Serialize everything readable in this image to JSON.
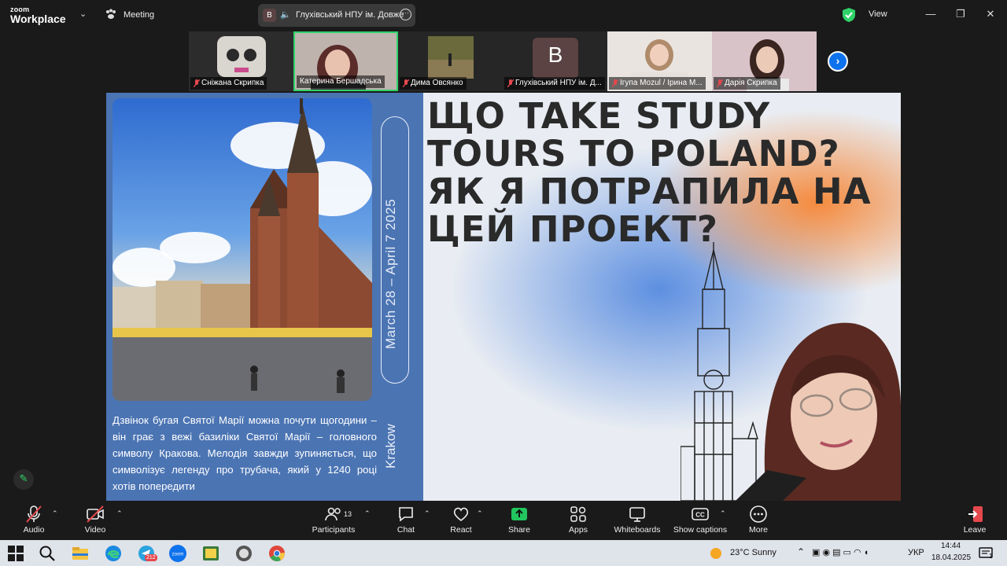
{
  "app": {
    "logo_top": "zoom",
    "logo_bottom": "Workplace",
    "meeting_label": "Meeting",
    "speaker_initial": "B",
    "speaker_name": "Глухівський НПУ ім. Довже",
    "view_label": "View"
  },
  "participants_strip": [
    {
      "name": "Сніжана Скрипка",
      "muted": true
    },
    {
      "name": "Катерина Бершадська",
      "muted": false,
      "active": true
    },
    {
      "name": "Дима Овсянко",
      "muted": true
    },
    {
      "name": "Глухівський НПУ ім. Д...",
      "muted": true,
      "initial": "B"
    },
    {
      "name": "Ігупа Mozul / Ірина М...",
      "muted": true
    },
    {
      "name": "Дарія Скрипка",
      "muted": true
    }
  ],
  "slide": {
    "title": "ЩО TAKE STUDY TOURS TO POLAND? ЯК Я ПОТРАПИЛА НА ЦЕЙ ПРОЕКТ?",
    "dates": "March 28 – April 7   2025",
    "city": "Krakow",
    "description": "Дзвінок бугая Святої Марії можна почути щогодини – він грає з вежі базиліки Святої Марії – головного символу Кракова. Мелодія завжди зупиняється, що символізує легенду про трубача, який у 1240 році хотів попередити"
  },
  "toolbar": {
    "audio": "Audio",
    "video": "Video",
    "participants": "Participants",
    "participants_count": "13",
    "chat": "Chat",
    "react": "React",
    "share": "Share",
    "apps": "Apps",
    "whiteboards": "Whiteboards",
    "captions": "Show captions",
    "more": "More",
    "leave": "Leave"
  },
  "taskbar": {
    "weather": "23°C  Sunny",
    "language": "УКР",
    "time": "14:44",
    "date": "18.04.2025",
    "notification_count": "1",
    "telegram_badge": "212"
  },
  "colors": {
    "accent_green": "#2fd36a",
    "accent_blue": "#0e72ed",
    "leave_red": "#e5484d",
    "share_green": "#22c55e"
  }
}
